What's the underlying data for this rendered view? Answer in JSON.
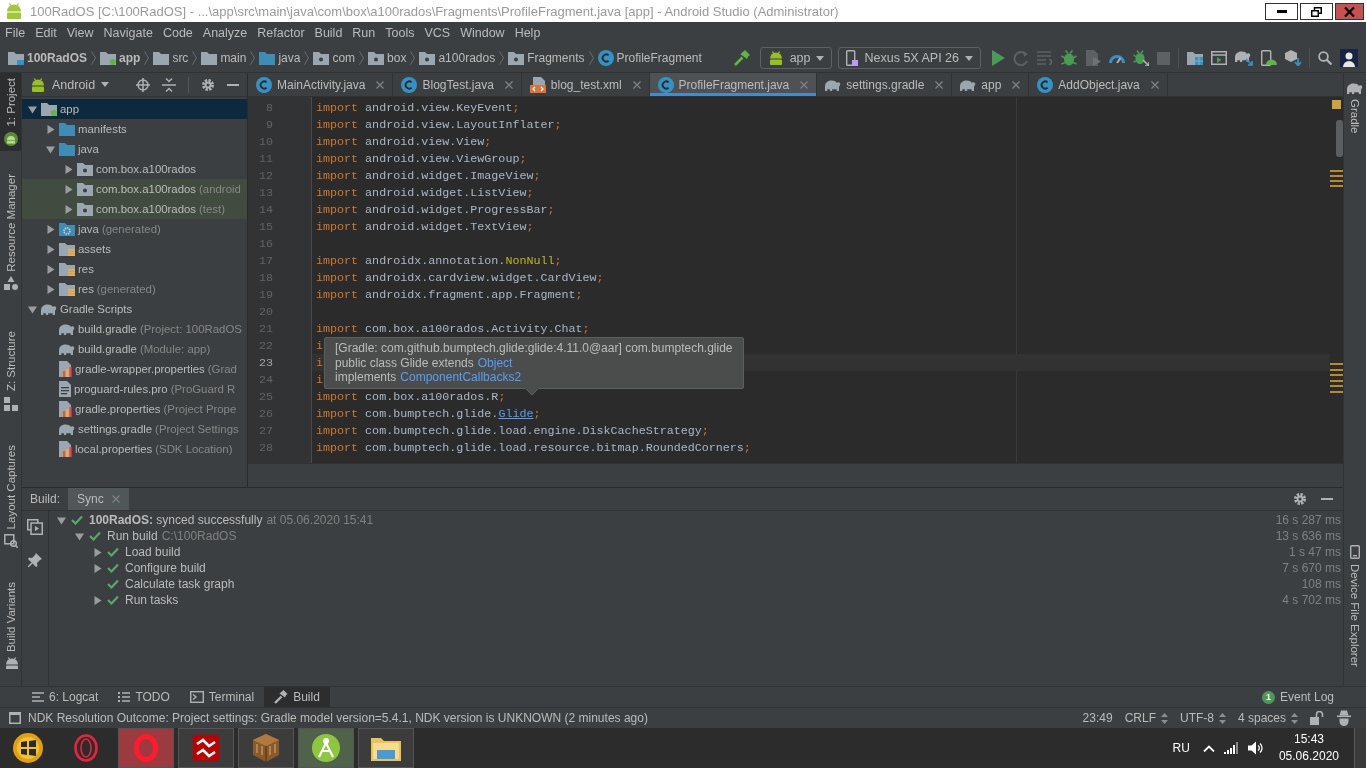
{
  "window": {
    "title": "100RadOS [C:\\100RadOS] - ...\\app\\src\\main\\java\\com\\box\\a100rados\\Fragments\\ProfileFragment.java [app] - Android Studio (Administrator)"
  },
  "menu": [
    "File",
    "Edit",
    "View",
    "Navigate",
    "Code",
    "Analyze",
    "Refactor",
    "Build",
    "Run",
    "Tools",
    "VCS",
    "Window",
    "Help"
  ],
  "breadcrumbs": [
    {
      "label": "100RadOS",
      "kind": "project"
    },
    {
      "label": "app",
      "kind": "module"
    },
    {
      "label": "src",
      "kind": "folder"
    },
    {
      "label": "main",
      "kind": "folder"
    },
    {
      "label": "java",
      "kind": "source"
    },
    {
      "label": "com",
      "kind": "package"
    },
    {
      "label": "box",
      "kind": "package"
    },
    {
      "label": "a100rados",
      "kind": "package"
    },
    {
      "label": "Fragments",
      "kind": "package"
    },
    {
      "label": "ProfileFragment",
      "kind": "class"
    }
  ],
  "toolbar": {
    "run_config": "app",
    "device": "Nexus 5X API 26"
  },
  "left_tool_strip": {
    "top": [
      {
        "label": "1: Project",
        "kind": "project",
        "selected": true
      },
      {
        "label": "Resource Manager",
        "kind": "resources",
        "selected": false
      }
    ],
    "bottom": [
      {
        "label": "Z: Structure",
        "kind": "structure",
        "selected": false
      },
      {
        "label": "Layout Captures",
        "kind": "captures",
        "selected": false
      },
      {
        "label": "Build Variants",
        "kind": "variants",
        "selected": false
      }
    ]
  },
  "right_tool_strip": {
    "top": [
      {
        "label": "Gradle",
        "kind": "gradle",
        "selected": false
      }
    ],
    "bottom": [
      {
        "label": "Device File Explorer",
        "kind": "device",
        "selected": false
      }
    ]
  },
  "project_panel": {
    "view": "Android",
    "tree": [
      {
        "label": "app",
        "kind": "module",
        "selected": true,
        "expanded": true,
        "children": [
          {
            "label": "manifests",
            "kind": "source-folder",
            "selected": false,
            "expanded": false
          },
          {
            "label": "java",
            "kind": "source-folder",
            "selected": false,
            "expanded": true,
            "children": [
              {
                "label": "com.box.a100rados",
                "kind": "package",
                "selected": false,
                "expanded": false
              },
              {
                "label": "com.box.a100rados",
                "note": "(android",
                "kind": "test-package",
                "selected": false,
                "expanded": false
              },
              {
                "label": "com.box.a100rados",
                "note": "(test)",
                "kind": "test-package",
                "selected": false,
                "expanded": false
              }
            ]
          },
          {
            "label": "java",
            "note": "(generated)",
            "kind": "generated-folder",
            "selected": false,
            "expanded": false
          },
          {
            "label": "assets",
            "kind": "resource-folder",
            "selected": false,
            "expanded": false
          },
          {
            "label": "res",
            "kind": "resource-folder",
            "selected": false,
            "expanded": false
          },
          {
            "label": "res",
            "note": "(generated)",
            "kind": "resource-folder",
            "selected": false,
            "expanded": false
          }
        ]
      },
      {
        "label": "Gradle Scripts",
        "kind": "gradle",
        "selected": false,
        "expanded": true,
        "children": [
          {
            "label": "build.gradle",
            "note": "(Project: 100RadOS",
            "kind": "gradle",
            "selected": false
          },
          {
            "label": "build.gradle",
            "note": "(Module: app)",
            "kind": "gradle",
            "selected": false
          },
          {
            "label": "gradle-wrapper.properties",
            "note": "(Grad",
            "kind": "properties",
            "selected": false
          },
          {
            "label": "proguard-rules.pro",
            "note": "(ProGuard R",
            "kind": "text",
            "selected": false
          },
          {
            "label": "gradle.properties",
            "note": "(Project Prope",
            "kind": "properties",
            "selected": false
          },
          {
            "label": "settings.gradle",
            "note": "(Project Settings",
            "kind": "gradle",
            "selected": false
          },
          {
            "label": "local.properties",
            "note": "(SDK Location)",
            "kind": "properties",
            "selected": false
          }
        ]
      }
    ]
  },
  "editor_tabs": [
    {
      "label": "MainActivity.java",
      "kind": "class",
      "selected": false
    },
    {
      "label": "BlogTest.java",
      "kind": "class",
      "selected": false
    },
    {
      "label": "blog_test.xml",
      "kind": "layout",
      "selected": false
    },
    {
      "label": "ProfileFragment.java",
      "kind": "class",
      "selected": true
    },
    {
      "label": "settings.gradle",
      "kind": "gradle",
      "selected": false
    },
    {
      "label": "app",
      "kind": "gradle",
      "selected": false
    },
    {
      "label": "AddObject.java",
      "kind": "class",
      "selected": false
    }
  ],
  "editor": {
    "lines": [
      {
        "number": "8",
        "current": false,
        "tokens": [
          {
            "kind": "keyword",
            "text": "import"
          },
          {
            "kind": "plain",
            "text": " android.view.KeyEvent"
          },
          {
            "kind": "keyword",
            "text": ";"
          }
        ]
      },
      {
        "number": "9",
        "current": false,
        "tokens": [
          {
            "kind": "keyword",
            "text": "import"
          },
          {
            "kind": "plain",
            "text": " android.view.LayoutInflater"
          },
          {
            "kind": "keyword",
            "text": ";"
          }
        ]
      },
      {
        "number": "10",
        "current": false,
        "tokens": [
          {
            "kind": "keyword",
            "text": "import"
          },
          {
            "kind": "plain",
            "text": " android.view.View"
          },
          {
            "kind": "keyword",
            "text": ";"
          }
        ]
      },
      {
        "number": "11",
        "current": false,
        "tokens": [
          {
            "kind": "keyword",
            "text": "import"
          },
          {
            "kind": "plain",
            "text": " android.view.ViewGroup"
          },
          {
            "kind": "keyword",
            "text": ";"
          }
        ]
      },
      {
        "number": "12",
        "current": false,
        "tokens": [
          {
            "kind": "keyword",
            "text": "import"
          },
          {
            "kind": "plain",
            "text": " android.widget.ImageView"
          },
          {
            "kind": "keyword",
            "text": ";"
          }
        ]
      },
      {
        "number": "13",
        "current": false,
        "tokens": [
          {
            "kind": "keyword",
            "text": "import"
          },
          {
            "kind": "plain",
            "text": " android.widget.ListView"
          },
          {
            "kind": "keyword",
            "text": ";"
          }
        ]
      },
      {
        "number": "14",
        "current": false,
        "tokens": [
          {
            "kind": "keyword",
            "text": "import"
          },
          {
            "kind": "plain",
            "text": " android.widget.ProgressBar"
          },
          {
            "kind": "keyword",
            "text": ";"
          }
        ]
      },
      {
        "number": "15",
        "current": false,
        "tokens": [
          {
            "kind": "keyword",
            "text": "import"
          },
          {
            "kind": "plain",
            "text": " android.widget.TextView"
          },
          {
            "kind": "keyword",
            "text": ";"
          }
        ]
      },
      {
        "number": "16",
        "current": false
      },
      {
        "number": "17",
        "current": false,
        "tokens": [
          {
            "kind": "keyword",
            "text": "import"
          },
          {
            "kind": "plain",
            "text": " androidx.annotation."
          },
          {
            "kind": "annotation",
            "text": "NonNull"
          },
          {
            "kind": "keyword",
            "text": ";"
          }
        ]
      },
      {
        "number": "18",
        "current": false,
        "tokens": [
          {
            "kind": "keyword",
            "text": "import"
          },
          {
            "kind": "plain",
            "text": " androidx.cardview.widget.CardView"
          },
          {
            "kind": "keyword",
            "text": ";"
          }
        ]
      },
      {
        "number": "19",
        "current": false,
        "tokens": [
          {
            "kind": "keyword",
            "text": "import"
          },
          {
            "kind": "plain",
            "text": " androidx.fragment.app.Fragment"
          },
          {
            "kind": "keyword",
            "text": ";"
          }
        ]
      },
      {
        "number": "20",
        "current": false
      },
      {
        "number": "21",
        "current": false,
        "tokens": [
          {
            "kind": "keyword",
            "text": "import"
          },
          {
            "kind": "plain",
            "text": " com.box.a100rados.Activity.Chat"
          },
          {
            "kind": "keyword",
            "text": ";"
          }
        ]
      },
      {
        "number": "22",
        "current": false,
        "tokens": [
          {
            "kind": "keyword",
            "text": "i"
          }
        ]
      },
      {
        "number": "23",
        "current": true,
        "tokens": [
          {
            "kind": "keyword",
            "text": "i"
          }
        ]
      },
      {
        "number": "24",
        "current": false,
        "tokens": [
          {
            "kind": "keyword",
            "text": "i"
          }
        ]
      },
      {
        "number": "25",
        "current": false,
        "tokens": [
          {
            "kind": "keyword",
            "text": "import"
          },
          {
            "kind": "plain",
            "text": " com.box.a100rados.R"
          },
          {
            "kind": "keyword",
            "text": ";"
          }
        ]
      },
      {
        "number": "26",
        "current": false,
        "tokens": [
          {
            "kind": "keyword",
            "text": "import"
          },
          {
            "kind": "plain",
            "text": " com.bumptech.glide."
          },
          {
            "kind": "link",
            "text": "Glide"
          },
          {
            "kind": "keyword",
            "text": ";"
          }
        ]
      },
      {
        "number": "27",
        "current": false,
        "tokens": [
          {
            "kind": "keyword",
            "text": "import"
          },
          {
            "kind": "plain",
            "text": " com.bumptech.glide.load.engine.DiskCacheStrategy"
          },
          {
            "kind": "keyword",
            "text": ";"
          }
        ]
      },
      {
        "number": "28",
        "current": false,
        "tokens": [
          {
            "kind": "keyword",
            "text": "import"
          },
          {
            "kind": "plain",
            "text": " com.bumptech.glide.load.resource.bitmap.RoundedCorners"
          },
          {
            "kind": "keyword",
            "text": ";"
          }
        ]
      }
    ],
    "quick_doc": {
      "lines": [
        {
          "text": "[Gradle: com.github.bumptech.glide:glide:4.11.0@aar] com.bumptech.glide"
        },
        {
          "text": "public class Glide extends",
          "link": "Object"
        },
        {
          "text": "implements",
          "link": "ComponentCallbacks2"
        }
      ]
    }
  },
  "build": {
    "label": "Build:",
    "tabs": [
      {
        "label": "Sync",
        "selected": true
      }
    ],
    "tree": [
      {
        "label": "**100RadOS:** synced successfully",
        "note": "at 05.06.2020 15:41",
        "duration": "16 s 287 ms",
        "kind": "success",
        "expanded": true,
        "children": [
          {
            "label": "Run build",
            "note": "C:\\100RadOS",
            "duration": "13 s 636 ms",
            "kind": "success",
            "expanded": true,
            "children": [
              {
                "label": "Load build",
                "duration": "1 s 47 ms",
                "kind": "success",
                "expanded": false
              },
              {
                "label": "Configure build",
                "duration": "7 s 670 ms",
                "kind": "success",
                "expanded": false
              },
              {
                "label": "Calculate task graph",
                "duration": "108 ms",
                "kind": "success"
              },
              {
                "label": "Run tasks",
                "duration": "4 s 702 ms",
                "kind": "success",
                "expanded": false
              }
            ]
          }
        ]
      }
    ]
  },
  "bottom_tools": [
    {
      "label": "6: Logcat",
      "kind": "logcat",
      "selected": false
    },
    {
      "label": "TODO",
      "kind": "todo",
      "selected": false
    },
    {
      "label": "Terminal",
      "kind": "terminal",
      "selected": false
    },
    {
      "label": "Build",
      "kind": "build",
      "selected": true
    }
  ],
  "event_log": {
    "label": "Event Log",
    "count": "1"
  },
  "status_bar": {
    "message": "NDK Resolution Outcome: Project settings: Gradle model version=5.4.1, NDK version is UNKNOWN (2 minutes ago)",
    "position": "23:49",
    "line_separator": "CRLF",
    "encoding": "UTF-8",
    "indent": "4 spaces"
  },
  "taskbar": {
    "apps": [
      {
        "kind": "ring-browser",
        "running": false,
        "flashing": false,
        "selected": false
      },
      {
        "kind": "browser",
        "running": true,
        "flashing": true,
        "selected": false
      },
      {
        "kind": "ftp",
        "running": true,
        "flashing": false,
        "selected": false
      },
      {
        "kind": "crate",
        "running": true,
        "flashing": false,
        "selected": false
      },
      {
        "kind": "ide",
        "running": true,
        "flashing": false,
        "selected": true
      },
      {
        "kind": "explorer",
        "running": true,
        "flashing": false,
        "selected": false
      }
    ],
    "language": "RU",
    "time": "15:43",
    "date": "05.06.2020"
  }
}
